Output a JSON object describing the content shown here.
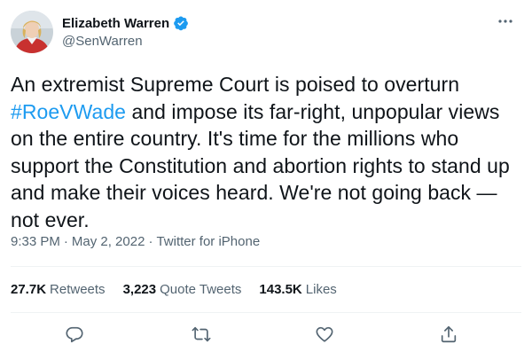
{
  "author": {
    "display_name": "Elizabeth Warren",
    "handle": "@SenWarren",
    "verified": true
  },
  "tweet": {
    "text_parts": [
      "An extremist Supreme Court is poised to overturn ",
      "#RoeVWade",
      " and impose its far-right, unpopular views on the entire country. It's time for the millions who support the Constitution and abortion rights to stand up and make their voices heard. We're not going back —not ever."
    ],
    "time": "9:33 PM",
    "date": "May 2, 2022",
    "source": "Twitter for iPhone",
    "separator": "·"
  },
  "stats": {
    "retweets_count": "27.7K",
    "retweets_label": "Retweets",
    "quotes_count": "3,223",
    "quotes_label": "Quote Tweets",
    "likes_count": "143.5K",
    "likes_label": "Likes"
  },
  "icons": {
    "verified": "verified-badge-icon",
    "more": "more-options-icon",
    "reply": "reply-icon",
    "retweet": "retweet-icon",
    "like": "heart-icon",
    "share": "share-icon"
  },
  "colors": {
    "accent": "#1d9bf0",
    "text": "#0f1419",
    "secondary": "#536471",
    "divider": "#eff3f4"
  }
}
